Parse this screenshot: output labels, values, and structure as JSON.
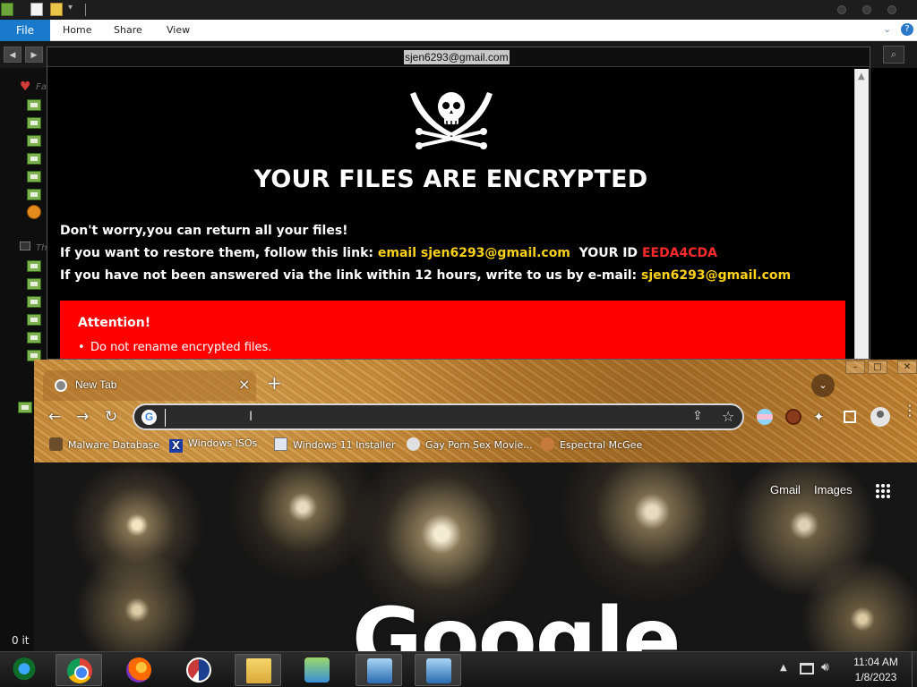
{
  "explorer": {
    "ribbon": {
      "file": "File",
      "tabs": [
        "Home",
        "Share",
        "View"
      ]
    },
    "nav_fragments": [
      "Fa",
      "Th"
    ],
    "status_items": "0 it"
  },
  "ransom_note": {
    "window_title": "sjen6293@gmail.com",
    "heading": "YOUR FILES ARE ENCRYPTED",
    "line1": "Don't worry,you can return all your files!",
    "line2_prefix": "If you want to restore them, follow this link: ",
    "line2_link": "email sjen6293@gmail.com",
    "line2_id_label": "YOUR ID ",
    "line2_id_value": "EEDA4CDA",
    "line3_prefix": "If you have not been answered via the link within 12 hours, write to us by e-mail: ",
    "line3_email": "sjen6293@gmail.com",
    "attention_title": "Attention!",
    "attention_items": [
      "Do not rename encrypted files."
    ]
  },
  "chrome": {
    "tab_title": "New Tab",
    "omnibox_value": "",
    "bookmarks": [
      "Malware Database",
      "Windows ISOs",
      "Windows 11 Installer",
      "Gay Porn Sex Movie...",
      "Espectral McGee"
    ],
    "page_links": [
      "Gmail",
      "Images"
    ],
    "logo": "Google"
  },
  "taskbar": {
    "time": "11:04 AM",
    "date": "1/8/2023"
  },
  "colors": {
    "accent_yellow": "#ffd21a",
    "id_red": "#ff2a2a",
    "attention_bg": "#ff0000",
    "ribbon_file_blue": "#1979ca"
  }
}
